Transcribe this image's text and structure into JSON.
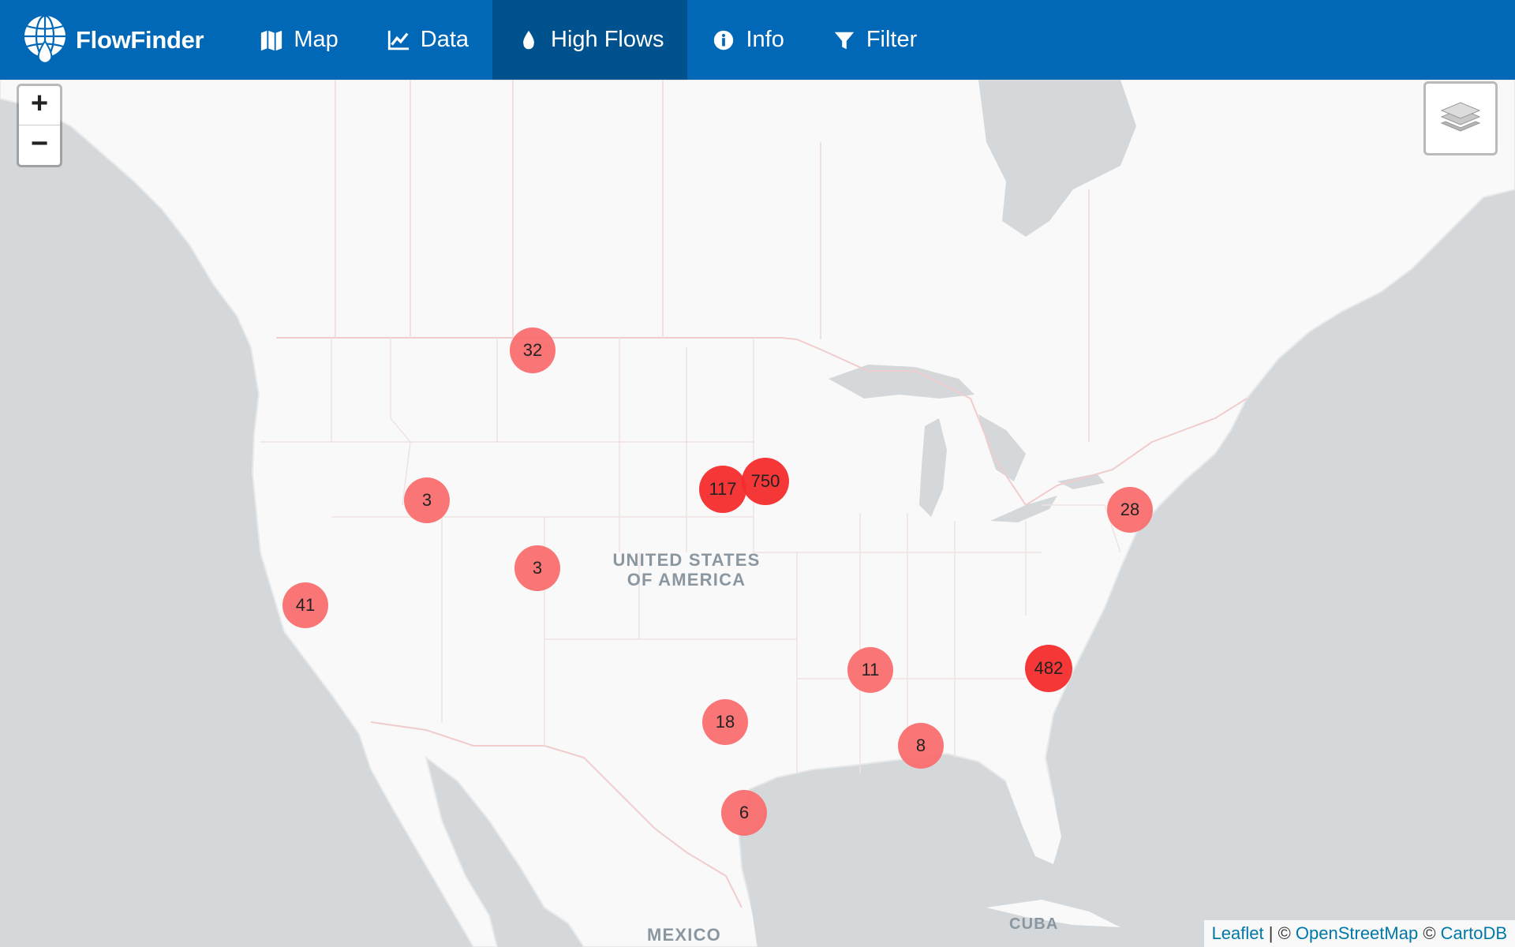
{
  "app": {
    "name": "FlowFinder"
  },
  "nav": {
    "items": [
      {
        "label": "Map",
        "icon": "map-icon",
        "active": false
      },
      {
        "label": "Data",
        "icon": "line-chart-icon",
        "active": false
      },
      {
        "label": "High Flows",
        "icon": "water-drop-icon",
        "active": true
      },
      {
        "label": "Info",
        "icon": "info-circle-icon",
        "active": false
      },
      {
        "label": "Filter",
        "icon": "filter-icon",
        "active": false
      }
    ]
  },
  "map": {
    "zoom_in_label": "+",
    "zoom_out_label": "−",
    "labels": {
      "country_line1": "UNITED STATES",
      "country_line2": "OF AMERICA",
      "mexico": "MEXICO",
      "cuba": "CUBA"
    },
    "clusters": [
      {
        "count": "32",
        "level": "small"
      },
      {
        "count": "3",
        "level": "small"
      },
      {
        "count": "117",
        "level": "large"
      },
      {
        "count": "750",
        "level": "large"
      },
      {
        "count": "28",
        "level": "small"
      },
      {
        "count": "3",
        "level": "small"
      },
      {
        "count": "41",
        "level": "small"
      },
      {
        "count": "11",
        "level": "small"
      },
      {
        "count": "482",
        "level": "large"
      },
      {
        "count": "18",
        "level": "small"
      },
      {
        "count": "8",
        "level": "small"
      },
      {
        "count": "6",
        "level": "small"
      }
    ],
    "attribution": {
      "leaflet": "Leaflet",
      "separator": " | © ",
      "osm": "OpenStreetMap",
      "copyright": " © ",
      "carto": "CartoDB"
    }
  },
  "colors": {
    "navbar": "#0068b7",
    "navbar_active": "#00528f",
    "water": "#d4d8db",
    "land": "#f9f9f9",
    "cluster_small": "#fa6e6e",
    "cluster_large": "#f42c2c"
  }
}
